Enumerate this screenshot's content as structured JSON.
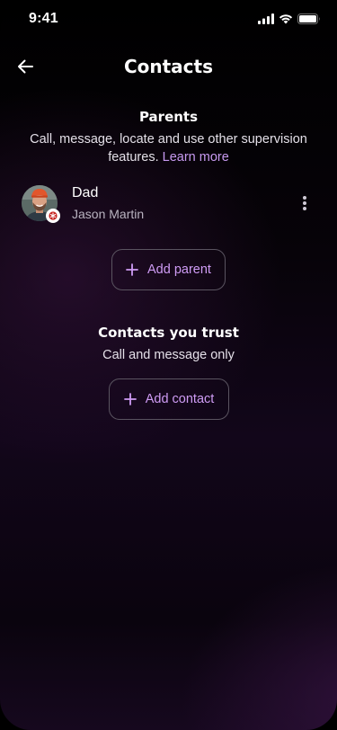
{
  "status_bar": {
    "time": "9:41",
    "icons": [
      "signal-icon",
      "wifi-icon",
      "battery-icon"
    ]
  },
  "header": {
    "title": "Contacts",
    "back_icon": "arrow-left-icon"
  },
  "parents": {
    "title": "Parents",
    "description": "Call, message, locate and use other supervision features.",
    "learn_more": "Learn more",
    "contacts": [
      {
        "name": "Dad",
        "subname": "Jason Martin",
        "avatar": "person-photo",
        "badge_icon": "asterisk-badge-icon",
        "menu_icon": "more-vertical-icon"
      }
    ],
    "add_button_label": "Add parent"
  },
  "trusted": {
    "title": "Contacts you trust",
    "description": "Call and message only",
    "add_button_label": "Add contact"
  },
  "colors": {
    "accent": "#c79af0",
    "button_text": "#cf9cf5",
    "button_border": "#5a5460",
    "background": "#000000",
    "badge_red": "#c5221f"
  }
}
